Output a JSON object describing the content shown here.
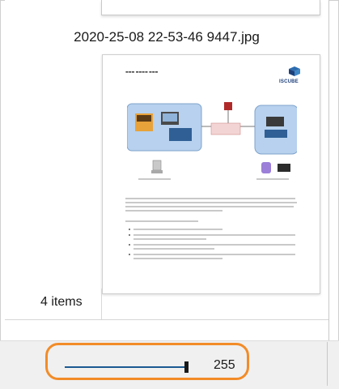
{
  "file_view": {
    "filename": "2020-25-08 22-53-46 9447.jpg",
    "thumbnail": {
      "logo_text": "ISCUBE"
    }
  },
  "status_bar": {
    "item_count": "4 items",
    "zoom_value": "255",
    "zoom_fraction": 0.995
  },
  "colors": {
    "slider_track": "#1b5a92",
    "highlight": "#f28c28",
    "diagram_box": "#b7d1ee"
  }
}
